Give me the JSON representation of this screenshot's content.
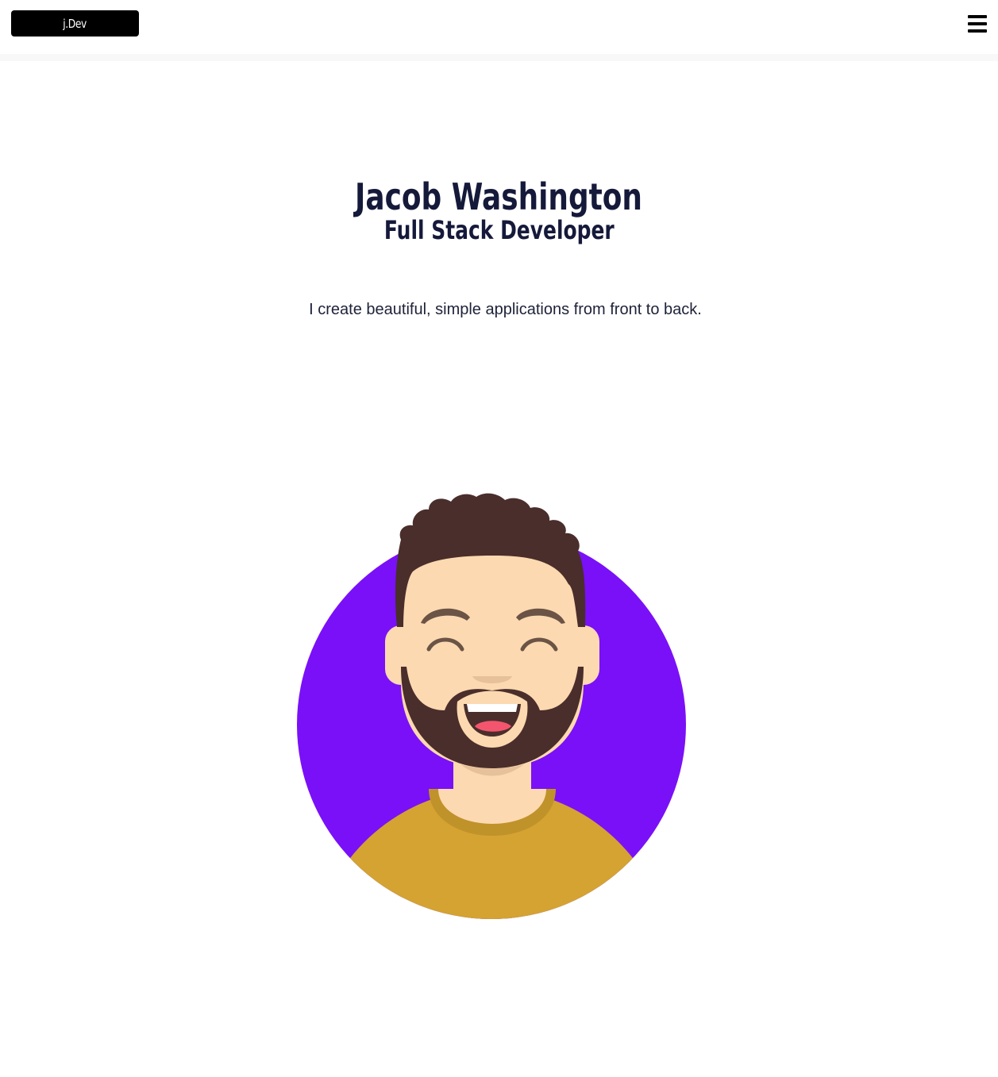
{
  "header": {
    "logo_text": "j.Dev",
    "menu_icon": "hamburger-menu-icon"
  },
  "hero": {
    "name": "Jacob Washington",
    "role": "Full Stack Developer",
    "tagline": "I create beautiful, simple applications from front to back."
  },
  "avatar": {
    "icon": "avatar-illustration",
    "colors": {
      "background": "#7a10f7",
      "skin": "#fcd9b0",
      "hair": "#4a2e2b",
      "shirt": "#d4a331",
      "collar": "#c0922a",
      "eyebrow": "#6b5446",
      "tongue": "#f4556e"
    }
  }
}
